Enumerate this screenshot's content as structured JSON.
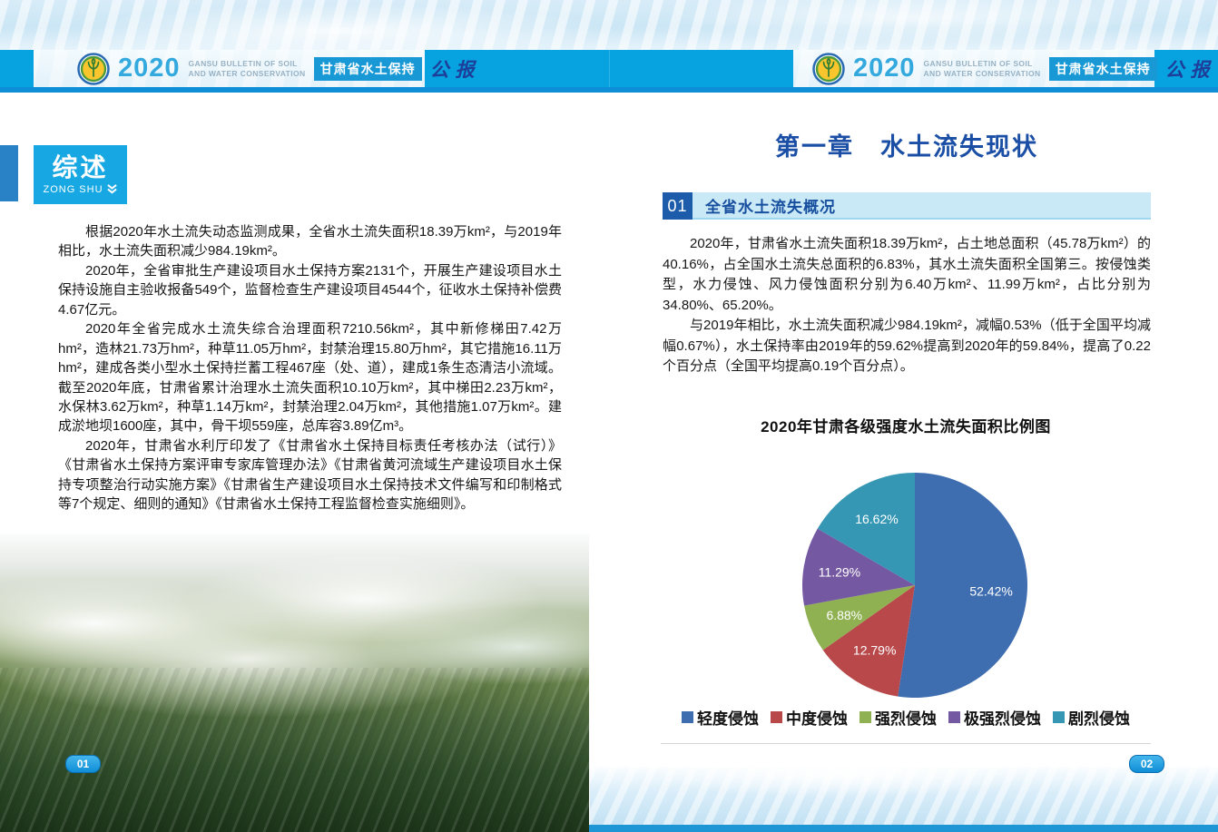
{
  "header": {
    "year": "2020",
    "english_title": "GANSU BULLETIN OF SOIL\nAND WATER CONSERVATION",
    "cn_badge": "甘肃省水土保持",
    "cn_gongbao": "公报"
  },
  "left_page": {
    "section_badge": {
      "title": "综述",
      "subtitle": "ZONG SHU"
    },
    "paragraphs": [
      "根据2020年水土流失动态监测成果，全省水土流失面积18.39万km²，与2019年相比，水土流失面积减少984.19km²。",
      "2020年，全省审批生产建设项目水土保持方案2131个，开展生产建设项目水土保持设施自主验收报备549个，监督检查生产建设项目4544个，征收水土保持补偿费4.67亿元。",
      "2020年全省完成水土流失综合治理面积7210.56km²，其中新修梯田7.42万hm²，造林21.73万hm²，种草11.05万hm²，封禁治理15.80万hm²，其它措施16.11万hm²，建成各类小型水土保持拦蓄工程467座（处、道），建成1条生态清洁小流域。截至2020年底，甘肃省累计治理水土流失面积10.10万km²，其中梯田2.23万km²，水保林3.62万km²，种草1.14万km²，封禁治理2.04万km²，其他措施1.07万km²。建成淤地坝1600座，其中，骨干坝559座，总库容3.89亿m³。",
      "2020年，甘肃省水利厅印发了《甘肃省水土保持目标责任考核办法（试行）》《甘肃省水土保持方案评审专家库管理办法》《甘肃省黄河流域生产建设项目水土保持专项整治行动实施方案》《甘肃省生产建设项目水土保持技术文件编写和印制格式等7个规定、细则的通知》《甘肃省水土保持工程监督检查实施细则》。"
    ],
    "page_number": "01"
  },
  "right_page": {
    "chapter_title": "第一章　水土流失现状",
    "section": {
      "number": "01",
      "title": "全省水土流失概况"
    },
    "paragraphs": [
      "2020年，甘肃省水土流失面积18.39万km²，占土地总面积（45.78万km²）的40.16%，占全国水土流失总面积的6.83%，其水土流失面积全国第三。按侵蚀类型，水力侵蚀、风力侵蚀面积分别为6.40万km²、11.99万km²，占比分别为34.80%、65.20%。",
      "与2019年相比，水土流失面积减少984.19km²，减幅0.53%（低于全国平均减幅0.67%），水土保持率由2019年的59.62%提高到2020年的59.84%，提高了0.22个百分点（全国平均提高0.19个百分点）。"
    ],
    "page_number": "02"
  },
  "chart_data": {
    "type": "pie",
    "title": "2020年甘肃各级强度水土流失面积比例图",
    "labels": [
      "轻度侵蚀",
      "中度侵蚀",
      "强烈侵蚀",
      "极强烈侵蚀",
      "剧烈侵蚀"
    ],
    "values": [
      52.42,
      12.79,
      6.88,
      11.29,
      16.62
    ],
    "colors": [
      "#3e6db0",
      "#b8484a",
      "#8fb152",
      "#7459a2",
      "#3597b4"
    ],
    "start_angle_deg": 0,
    "direction": "clockwise",
    "value_format": "percent",
    "label_color": "#ffffff",
    "legend_position": "bottom"
  },
  "colors": {
    "header_block_blue": "#07a2e0",
    "header_strip_blue": "#0d8ed6",
    "badge_cyan": "#17a7e2",
    "section_number_blue": "#1d5cab",
    "section_bar_bg": "#c9e9f7",
    "chapter_title_blue": "#1b4fa5",
    "page_pill_blue": "#0f8ed6"
  }
}
